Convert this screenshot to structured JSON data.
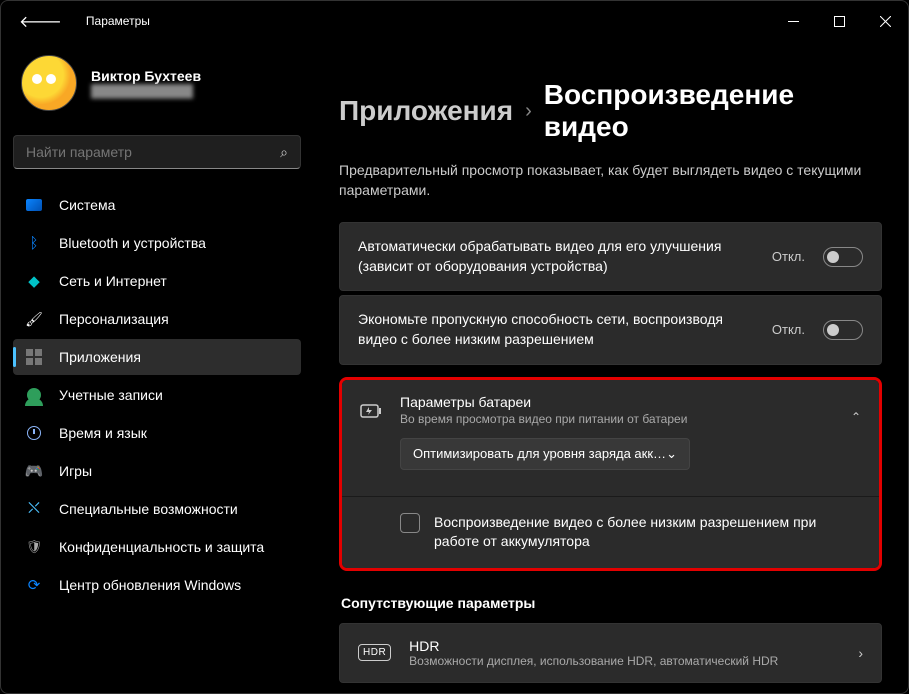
{
  "titlebar": {
    "app_name": "Параметры"
  },
  "profile": {
    "name": "Виктор Бухтеев",
    "email": "████████████"
  },
  "search": {
    "placeholder": "Найти параметр"
  },
  "nav": {
    "items": [
      {
        "label": "Система"
      },
      {
        "label": "Bluetooth и устройства"
      },
      {
        "label": "Сеть и Интернет"
      },
      {
        "label": "Персонализация"
      },
      {
        "label": "Приложения"
      },
      {
        "label": "Учетные записи"
      },
      {
        "label": "Время и язык"
      },
      {
        "label": "Игры"
      },
      {
        "label": "Специальные возможности"
      },
      {
        "label": "Конфиденциальность и защита"
      },
      {
        "label": "Центр обновления Windows"
      }
    ]
  },
  "breadcrumb": {
    "parent": "Приложения",
    "current": "Воспроизведение видео"
  },
  "description": "Предварительный просмотр показывает, как будет выглядеть видео с текущими параметрами.",
  "settings": {
    "auto_enhance": {
      "label": "Автоматически обрабатывать видео для его улучшения (зависит от оборудования устройства)",
      "state": "Откл."
    },
    "save_bandwidth": {
      "label": "Экономьте пропускную способность сети, воспроизводя видео с более низким разрешением",
      "state": "Откл."
    },
    "battery": {
      "title": "Параметры батареи",
      "subtitle": "Во время просмотра видео при питании от батареи",
      "dropdown_value": "Оптимизировать для уровня заряда акк…",
      "checkbox_label": "Воспроизведение видео с более низким разрешением при работе от аккумулятора"
    }
  },
  "related": {
    "heading": "Сопутствующие параметры",
    "hdr": {
      "title": "HDR",
      "subtitle": "Возможности дисплея, использование HDR, автоматический HDR",
      "badge": "HDR"
    }
  }
}
